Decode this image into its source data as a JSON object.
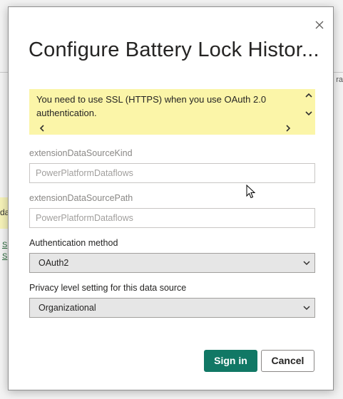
{
  "background": {
    "yellow_fragment": "da",
    "link_1": "S",
    "link_2": "S",
    "right_fragment": "ra"
  },
  "dialog": {
    "title": "Configure Battery Lock Histor...",
    "warning": "You need to use SSL (HTTPS) when you use OAuth 2.0 authentication.",
    "fields": {
      "kind_label": "extensionDataSourceKind",
      "kind_value": "PowerPlatformDataflows",
      "path_label": "extensionDataSourcePath",
      "path_value": "PowerPlatformDataflows"
    },
    "auth": {
      "label": "Authentication method",
      "selected": "OAuth2"
    },
    "privacy": {
      "label": "Privacy level setting for this data source",
      "selected": "Organizational"
    },
    "buttons": {
      "sign_in": "Sign in",
      "cancel": "Cancel"
    }
  },
  "colors": {
    "primary": "#117865",
    "warning_bg": "#fbf5a8"
  }
}
